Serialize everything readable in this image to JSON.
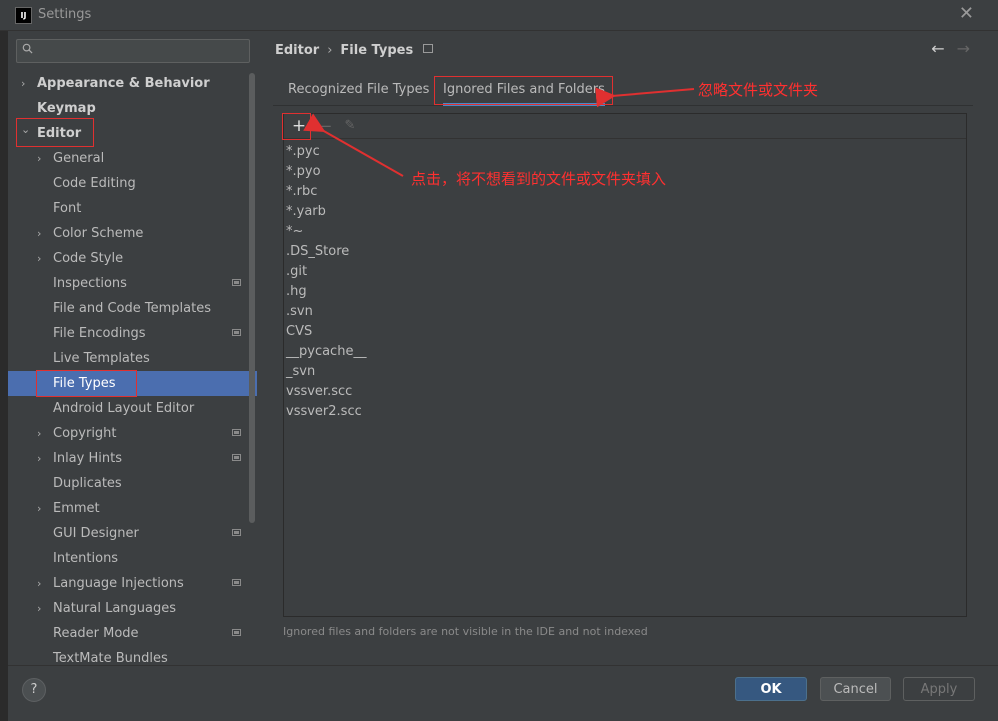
{
  "window": {
    "title": "Settings",
    "app_icon_text": "IJ"
  },
  "sidebar": {
    "search_placeholder": "",
    "items": [
      {
        "label": "Appearance & Behavior",
        "level": 0,
        "expander": "collapsed",
        "bold": true,
        "settings_badge": false
      },
      {
        "label": "Keymap",
        "level": 0,
        "expander": "none",
        "bold": true,
        "settings_badge": false
      },
      {
        "label": "Editor",
        "level": 0,
        "expander": "expanded",
        "bold": true,
        "settings_badge": false
      },
      {
        "label": "General",
        "level": 1,
        "expander": "collapsed",
        "bold": false,
        "settings_badge": false
      },
      {
        "label": "Code Editing",
        "level": 1,
        "expander": "none",
        "bold": false,
        "settings_badge": false
      },
      {
        "label": "Font",
        "level": 1,
        "expander": "none",
        "bold": false,
        "settings_badge": false
      },
      {
        "label": "Color Scheme",
        "level": 1,
        "expander": "collapsed",
        "bold": false,
        "settings_badge": false
      },
      {
        "label": "Code Style",
        "level": 1,
        "expander": "collapsed",
        "bold": false,
        "settings_badge": false
      },
      {
        "label": "Inspections",
        "level": 1,
        "expander": "none",
        "bold": false,
        "settings_badge": true
      },
      {
        "label": "File and Code Templates",
        "level": 1,
        "expander": "none",
        "bold": false,
        "settings_badge": false
      },
      {
        "label": "File Encodings",
        "level": 1,
        "expander": "none",
        "bold": false,
        "settings_badge": true
      },
      {
        "label": "Live Templates",
        "level": 1,
        "expander": "none",
        "bold": false,
        "settings_badge": false
      },
      {
        "label": "File Types",
        "level": 1,
        "expander": "none",
        "bold": false,
        "settings_badge": false,
        "selected": true
      },
      {
        "label": "Android Layout Editor",
        "level": 1,
        "expander": "none",
        "bold": false,
        "settings_badge": false
      },
      {
        "label": "Copyright",
        "level": 1,
        "expander": "collapsed",
        "bold": false,
        "settings_badge": true
      },
      {
        "label": "Inlay Hints",
        "level": 1,
        "expander": "collapsed",
        "bold": false,
        "settings_badge": true
      },
      {
        "label": "Duplicates",
        "level": 1,
        "expander": "none",
        "bold": false,
        "settings_badge": false
      },
      {
        "label": "Emmet",
        "level": 1,
        "expander": "collapsed",
        "bold": false,
        "settings_badge": false
      },
      {
        "label": "GUI Designer",
        "level": 1,
        "expander": "none",
        "bold": false,
        "settings_badge": true
      },
      {
        "label": "Intentions",
        "level": 1,
        "expander": "none",
        "bold": false,
        "settings_badge": false
      },
      {
        "label": "Language Injections",
        "level": 1,
        "expander": "collapsed",
        "bold": false,
        "settings_badge": true
      },
      {
        "label": "Natural Languages",
        "level": 1,
        "expander": "collapsed",
        "bold": false,
        "settings_badge": false
      },
      {
        "label": "Reader Mode",
        "level": 1,
        "expander": "none",
        "bold": false,
        "settings_badge": true
      },
      {
        "label": "TextMate Bundles",
        "level": 1,
        "expander": "none",
        "bold": false,
        "settings_badge": false
      }
    ]
  },
  "header": {
    "breadcrumb": [
      "Editor",
      "File Types"
    ],
    "separator": "›",
    "back_icon": "←",
    "forward_icon": "→"
  },
  "tabs": [
    {
      "label": "Recognized File Types",
      "active": false
    },
    {
      "label": "Ignored Files and Folders",
      "active": true
    }
  ],
  "toolbar": {
    "add_icon": "+",
    "remove_icon": "−",
    "edit_icon": "✎"
  },
  "ignored_list": [
    "*.pyc",
    "*.pyo",
    "*.rbc",
    "*.yarb",
    "*~",
    ".DS_Store",
    ".git",
    ".hg",
    ".svn",
    "CVS",
    "__pycache__",
    "_svn",
    "vssver.scc",
    "vssver2.scc"
  ],
  "hint_text": "Ignored files and folders are not visible in the IDE and not indexed",
  "annotations": {
    "tab_note": "忽略文件或文件夹",
    "add_note": "点击，将不想看到的文件或文件夹填入"
  },
  "footer": {
    "help_label": "?",
    "ok_label": "OK",
    "cancel_label": "Cancel",
    "apply_label": "Apply"
  },
  "colors": {
    "accent": "#4b6eaf",
    "annotation_red": "#e03030",
    "ok_button": "#365880"
  }
}
